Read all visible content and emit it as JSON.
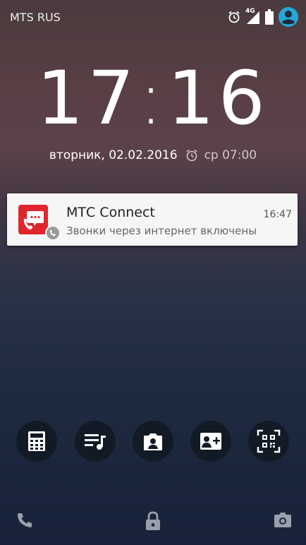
{
  "status_bar": {
    "carrier": "MTS RUS",
    "network": "4G",
    "icons": [
      "alarm-icon",
      "signal-icon",
      "battery-icon",
      "account-icon"
    ],
    "accent_color": "#26a7d9"
  },
  "lockscreen": {
    "time_hours": "17",
    "time_minutes": "16",
    "date": "вторник, 02.02.2016",
    "next_alarm": "ср 07:00"
  },
  "notification": {
    "app_name": "МТС Connect",
    "text": "Звонки через интернет включены",
    "time": "16:47",
    "app_color": "#e0262c"
  },
  "shortcuts": [
    "calculator-icon",
    "music-playlist-icon",
    "camera-front-icon",
    "add-contact-icon",
    "qr-scanner-icon"
  ],
  "bottom_bar": [
    "phone-icon",
    "lock-icon",
    "camera-icon"
  ]
}
